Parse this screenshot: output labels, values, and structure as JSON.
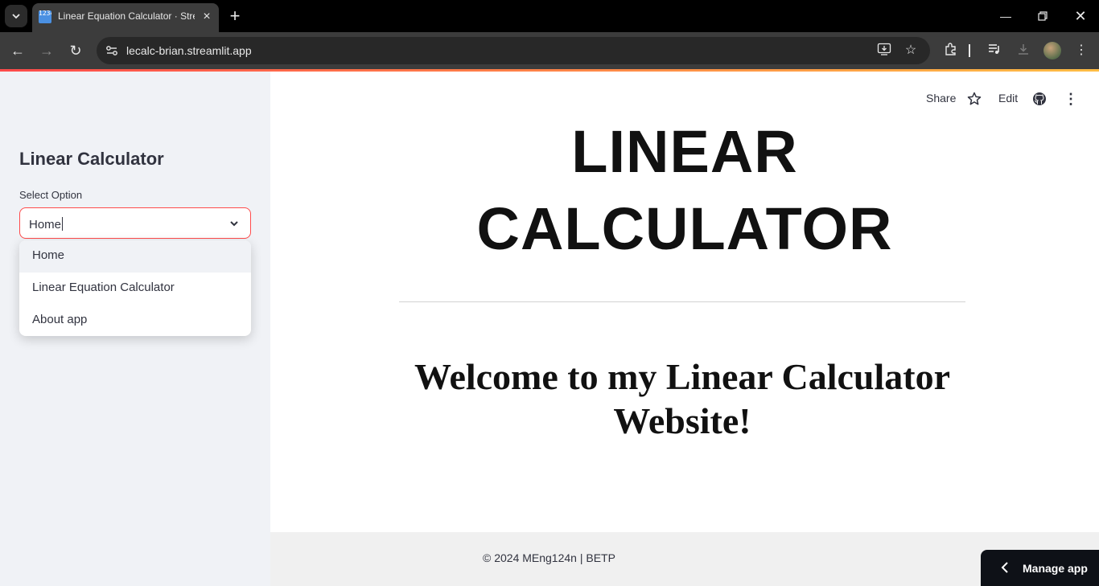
{
  "browser": {
    "tab_title": "Linear Equation Calculator · Streamlit",
    "tab_icon_text": "1234",
    "url": "lecalc-brian.streamlit.app"
  },
  "sidebar": {
    "title": "Linear Calculator",
    "select_label": "Select Option",
    "select_value": "Home",
    "options": [
      {
        "label": "Home",
        "active": true
      },
      {
        "label": "Linear Equation Calculator",
        "active": false
      },
      {
        "label": "About app",
        "active": false
      }
    ]
  },
  "header": {
    "share_label": "Share",
    "edit_label": "Edit"
  },
  "main": {
    "hero_line1": "LINEAR",
    "hero_line2": "CALCULATOR",
    "welcome_line1": "Welcome to my Linear Calculator",
    "welcome_line2": "Website!"
  },
  "footer": {
    "text": "© 2024 MEng124n | BETP"
  },
  "manage_app": {
    "label": "Manage app"
  },
  "colors": {
    "accent": "#ff4b4b",
    "sidebar_bg": "#f0f2f6",
    "text": "#31333f"
  }
}
